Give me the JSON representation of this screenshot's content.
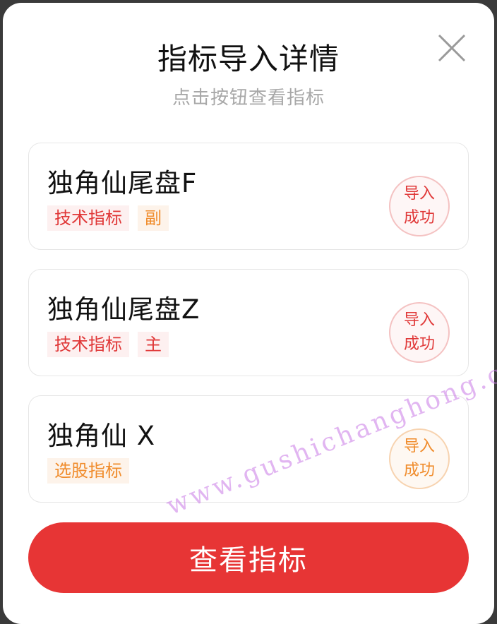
{
  "dialog": {
    "title": "指标导入详情",
    "subtitle": "点击按钮查看指标",
    "close_icon": "close-icon"
  },
  "cards": [
    {
      "name": "独角仙尾盘F",
      "tags": [
        {
          "label": "技术指标",
          "color": "#e03838"
        },
        {
          "label": "副",
          "color": "#f08c2c"
        }
      ],
      "status_line1": "导入",
      "status_line2": "成功",
      "status_color": "#e03838"
    },
    {
      "name": "独角仙尾盘Z",
      "tags": [
        {
          "label": "技术指标",
          "color": "#e03838"
        },
        {
          "label": "主",
          "color": "#e03838"
        }
      ],
      "status_line1": "导入",
      "status_line2": "成功",
      "status_color": "#e03838"
    },
    {
      "name": "独角仙 X",
      "tags": [
        {
          "label": "选股指标",
          "color": "#f08c2c"
        }
      ],
      "status_line1": "导入",
      "status_line2": "成功",
      "status_color": "#f08c2c"
    }
  ],
  "cta": {
    "label": "查看指标",
    "color": "#e73535"
  },
  "watermark": "www.gushichanghong.com"
}
